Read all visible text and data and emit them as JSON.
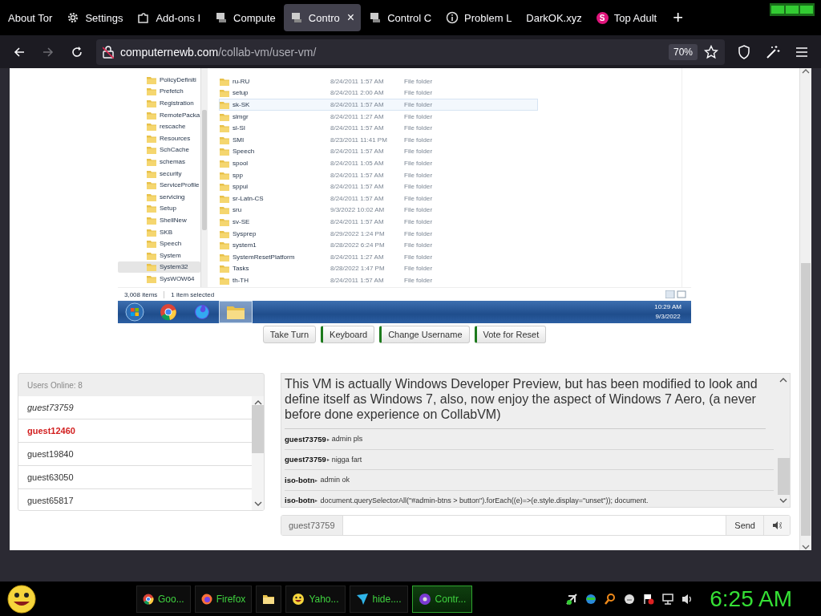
{
  "browser": {
    "tabs": [
      {
        "label": "About Tor",
        "kind": "plain",
        "selected": false
      },
      {
        "label": "Settings",
        "kind": "settings",
        "selected": false
      },
      {
        "label": "Add-ons I",
        "kind": "addon",
        "selected": false
      },
      {
        "label": "Compute",
        "kind": "vm",
        "selected": false
      },
      {
        "label": "Contro",
        "kind": "vm",
        "selected": true
      },
      {
        "label": "Control C",
        "kind": "vm",
        "selected": false
      },
      {
        "label": "Problem L",
        "kind": "info",
        "selected": false
      },
      {
        "label": "DarkOK.xyz",
        "kind": "plain",
        "selected": false
      },
      {
        "label": "Top Adult",
        "kind": "badge",
        "badge": "S",
        "selected": false
      }
    ],
    "new_tab": "+",
    "close_tab": "×",
    "url": {
      "host": "computernewb.com",
      "path": "/collab-vm/user-vm/"
    },
    "zoom": "70%"
  },
  "vm": {
    "folders": [
      {
        "label": "PolicyDefiniti",
        "selected": false
      },
      {
        "label": "Prefetch",
        "selected": false
      },
      {
        "label": "Registration",
        "selected": false
      },
      {
        "label": "RemotePacka",
        "selected": false
      },
      {
        "label": "rescache",
        "selected": false
      },
      {
        "label": "Resources",
        "selected": false
      },
      {
        "label": "SchCache",
        "selected": false
      },
      {
        "label": "schemas",
        "selected": false
      },
      {
        "label": "security",
        "selected": false
      },
      {
        "label": "ServiceProfile",
        "selected": false
      },
      {
        "label": "servicing",
        "selected": false
      },
      {
        "label": "Setup",
        "selected": false
      },
      {
        "label": "ShellNew",
        "selected": false
      },
      {
        "label": "SKB",
        "selected": false
      },
      {
        "label": "Speech",
        "selected": false
      },
      {
        "label": "System",
        "selected": false
      },
      {
        "label": "System32",
        "selected": true
      },
      {
        "label": "SysWOW64",
        "selected": false
      }
    ],
    "files": [
      {
        "name": "ru-RU",
        "date": "8/24/2011 1:57 AM",
        "type": "File folder",
        "selected": false
      },
      {
        "name": "setup",
        "date": "8/24/2011 2:00 AM",
        "type": "File folder",
        "selected": false
      },
      {
        "name": "sk-SK",
        "date": "8/24/2011 1:57 AM",
        "type": "File folder",
        "selected": true
      },
      {
        "name": "slmgr",
        "date": "8/24/2011 1:27 AM",
        "type": "File folder",
        "selected": false
      },
      {
        "name": "sl-SI",
        "date": "8/24/2011 1:57 AM",
        "type": "File folder",
        "selected": false
      },
      {
        "name": "SMI",
        "date": "8/23/2011 11:41 PM",
        "type": "File folder",
        "selected": false
      },
      {
        "name": "Speech",
        "date": "8/24/2011 1:57 AM",
        "type": "File folder",
        "selected": false
      },
      {
        "name": "spool",
        "date": "8/24/2011 1:05 AM",
        "type": "File folder",
        "selected": false
      },
      {
        "name": "spp",
        "date": "8/24/2011 1:57 AM",
        "type": "File folder",
        "selected": false
      },
      {
        "name": "sppui",
        "date": "8/24/2011 1:57 AM",
        "type": "File folder",
        "selected": false
      },
      {
        "name": "sr-Latn-CS",
        "date": "8/24/2011 1:57 AM",
        "type": "File folder",
        "selected": false
      },
      {
        "name": "sru",
        "date": "9/3/2022 10:02 AM",
        "type": "File folder",
        "selected": false
      },
      {
        "name": "sv-SE",
        "date": "8/24/2011 1:57 AM",
        "type": "File folder",
        "selected": false
      },
      {
        "name": "Sysprep",
        "date": "8/29/2022 1:24 PM",
        "type": "File folder",
        "selected": false
      },
      {
        "name": "system1",
        "date": "8/28/2022 6:24 PM",
        "type": "File folder",
        "selected": false
      },
      {
        "name": "SystemResetPlatform",
        "date": "8/24/2011 1:27 AM",
        "type": "File folder",
        "selected": false
      },
      {
        "name": "Tasks",
        "date": "8/28/2022 1:47 PM",
        "type": "File folder",
        "selected": false
      },
      {
        "name": "th-TH",
        "date": "8/24/2011 1:57 AM",
        "type": "File folder",
        "selected": false
      }
    ],
    "status": {
      "items": "3,008 items",
      "selection": "1 item selected"
    },
    "taskbar": [
      {
        "kind": "chrome",
        "selected": false
      },
      {
        "kind": "firefox",
        "selected": false
      },
      {
        "kind": "explorer",
        "selected": true
      }
    ],
    "time": "10:29 AM",
    "date": "9/3/2022"
  },
  "vm_buttons": [
    "Take Turn",
    "Keyboard",
    "Change Username",
    "Vote for Reset"
  ],
  "users": {
    "header": "Users Online: 8",
    "list": [
      {
        "name": "guest73759",
        "kind": "self"
      },
      {
        "name": "guest12460",
        "kind": "admin"
      },
      {
        "name": "guest19840",
        "kind": "normal"
      },
      {
        "name": "guest63050",
        "kind": "normal"
      },
      {
        "name": "guest65817",
        "kind": "normal"
      }
    ]
  },
  "chat": {
    "motd": "This VM is actually Windows Developer Preview, but has been modified to look and define itself as Windows 7, also, now enjoy the aspect of Windows 7 Aero, (a never before done experience on CollabVM)",
    "messages": [
      {
        "user": "guest73759",
        "separator": "▸",
        "text": "admin pls"
      },
      {
        "user": "guest73759",
        "separator": "▸",
        "text": "nigga fart"
      },
      {
        "user": "iso-botn",
        "separator": "▸",
        "text": "admin ok"
      },
      {
        "user": "iso-botn",
        "separator": "▸",
        "text": "document.querySelectorAll(\"#admin-btns > button\").forEach((e)=>(e.style.display=\"unset\")); document."
      }
    ],
    "username": "guest73759",
    "send": "Send"
  },
  "os_taskbar": {
    "items": [
      {
        "label": "Goo...",
        "kind": "chrome",
        "selected": false
      },
      {
        "label": "Firefox",
        "kind": "firefox",
        "selected": false
      },
      {
        "kind": "folder",
        "selected": false
      },
      {
        "label": "Yaho...",
        "kind": "smiley",
        "selected": false
      },
      {
        "label": "hide....",
        "kind": "arrow",
        "selected": false
      },
      {
        "label": "Contr...",
        "kind": "vm",
        "selected": true
      }
    ],
    "clock": "6:25 AM"
  }
}
